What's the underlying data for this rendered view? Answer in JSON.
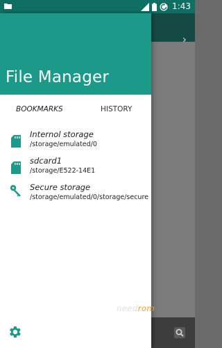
{
  "status_bar": {
    "time": "1:43",
    "icons": [
      "folder-icon",
      "signal-icon",
      "battery-icon",
      "sync-icon"
    ]
  },
  "drawer": {
    "title": "File Manager",
    "tabs": [
      {
        "label": "BOOKMARKS",
        "selected": true
      },
      {
        "label": "HISTORY",
        "selected": false
      }
    ],
    "bookmarks": [
      {
        "title": "Internol storage",
        "path": "/storage/emulated/0",
        "icon": "sd-card-icon"
      },
      {
        "title": "sdcard1",
        "path": "/storage/E522-14E1",
        "icon": "sd-card-icon"
      },
      {
        "title": "Secure storage",
        "path": "/storage/emulated/0/storage/secure",
        "icon": "key-icon"
      }
    ],
    "settings_icon": "gear-icon"
  },
  "background": {
    "toolbar_icon": "chevron-right-icon",
    "bottom_icon": "search-icon"
  },
  "watermark": {
    "part1": "need",
    "part2": "rom"
  },
  "colors": {
    "header": "#1b9a8a",
    "status_bar": "#0e6f63",
    "accent": "#1b9a8a"
  }
}
